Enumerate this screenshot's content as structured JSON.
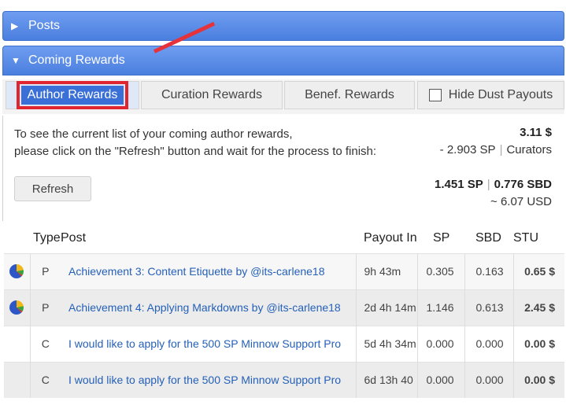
{
  "posts_section": {
    "label": "Posts"
  },
  "rewards_section": {
    "label": "Coming Rewards"
  },
  "tabs": {
    "author": "Author Rewards",
    "curation": "Curation Rewards",
    "benef": "Benef. Rewards",
    "hide_dust": "Hide Dust Payouts"
  },
  "info": {
    "line1": "To see the current list of your coming author rewards,",
    "line2": "please click on the \"Refresh\" button and wait for the process to finish:"
  },
  "refresh_label": "Refresh",
  "summary": {
    "total": "3.11 $",
    "curators_sp": "- 2.903 SP",
    "curators_label": "Curators",
    "sp": "1.451 SP",
    "sbd": "0.776 SBD",
    "usd": "~ 6.07 USD"
  },
  "table": {
    "headers": {
      "type": "Type",
      "post": "Post",
      "payout": "Payout In",
      "sp": "SP",
      "sbd": "SBD",
      "stu": "STU"
    },
    "rows": [
      {
        "icon": "pie-chart-icon",
        "type": "P",
        "post": "Achievement 3: Content Etiquette by @its-carlene18",
        "payout": "9h 43m",
        "sp": "0.305",
        "sbd": "0.163",
        "stu": "0.65 $"
      },
      {
        "icon": "pie-chart-icon",
        "type": "P",
        "post": "Achievement 4: Applying Markdowns by @its-carlene18",
        "payout": "2d 4h 14m",
        "sp": "1.146",
        "sbd": "0.613",
        "stu": "2.45 $"
      },
      {
        "icon": "",
        "type": "C",
        "post": "I would like to apply for the 500 SP Minnow Support Pro",
        "payout": "5d 4h 34m",
        "sp": "0.000",
        "sbd": "0.000",
        "stu": "0.00 $"
      },
      {
        "icon": "",
        "type": "C",
        "post": "I would like to apply for the 500 SP Minnow Support Pro",
        "payout": "6d 13h 40",
        "sp": "0.000",
        "sbd": "0.000",
        "stu": "0.00 $"
      }
    ]
  },
  "colors": {
    "header_blue": "#4a7fdf",
    "payout_green": "#25a82b",
    "link_blue": "#2560b8",
    "highlight_red": "#e02430"
  }
}
